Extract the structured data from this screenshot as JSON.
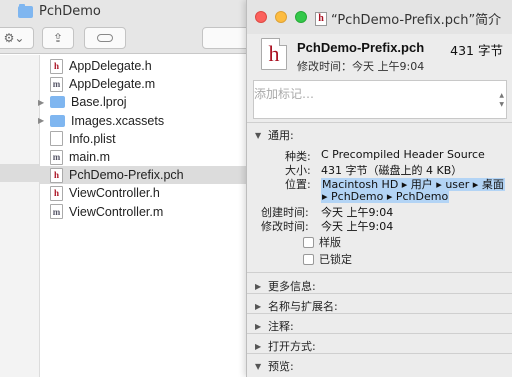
{
  "finder": {
    "title": "PchDemo",
    "files": [
      {
        "name": "AppDelegate.h",
        "kind": "h",
        "icon": "header-file-icon"
      },
      {
        "name": "AppDelegate.m",
        "kind": "m",
        "icon": "source-file-icon"
      },
      {
        "name": "Base.lproj",
        "kind": "folder",
        "icon": "folder-icon"
      },
      {
        "name": "Images.xcassets",
        "kind": "folder",
        "icon": "folder-icon"
      },
      {
        "name": "Info.plist",
        "kind": "plain",
        "icon": "document-icon"
      },
      {
        "name": "main.m",
        "kind": "m",
        "icon": "source-file-icon"
      },
      {
        "name": "PchDemo-Prefix.pch",
        "kind": "h",
        "icon": "header-file-icon",
        "selected": true
      },
      {
        "name": "ViewController.h",
        "kind": "h",
        "icon": "header-file-icon"
      },
      {
        "name": "ViewController.m",
        "kind": "m",
        "icon": "source-file-icon"
      }
    ]
  },
  "info": {
    "window_title": "“PchDemo-Prefix.pch”简介",
    "file_name": "PchDemo-Prefix.pch",
    "file_size": "431 字节",
    "modified_summary": "修改时间：今天 上午9:04",
    "tags_placeholder": "添加标记…",
    "general": {
      "heading": "通用:",
      "kind_label": "种类:",
      "kind_value": "C Precompiled Header Source",
      "size_label": "大小:",
      "size_value": "431 字节（磁盘上的 4 KB）",
      "where_label": "位置:",
      "where_line1": "Macintosh HD ▸ 用户 ▸ user ▸ 桌面",
      "where_line2": "▸ PchDemo ▸ PchDemo",
      "created_label": "创建时间:",
      "created_value": "今天 上午9:04",
      "modified_label": "修改时间:",
      "modified_value": "今天 上午9:04",
      "stationery_label": "样版",
      "locked_label": "已锁定"
    },
    "sections": [
      {
        "label": "更多信息:"
      },
      {
        "label": "名称与扩展名:"
      },
      {
        "label": "注释:"
      },
      {
        "label": "打开方式:"
      },
      {
        "label": "预览:"
      }
    ]
  }
}
